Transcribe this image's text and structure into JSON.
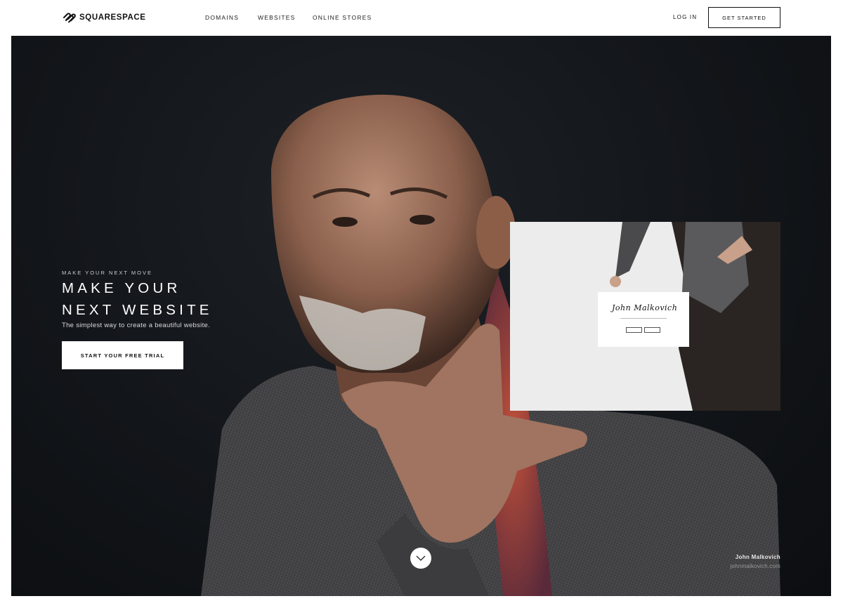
{
  "brand": {
    "name": "SQUARESPACE",
    "logo_icon": "squarespace-logo-icon"
  },
  "nav": {
    "items": [
      {
        "label": "DOMAINS"
      },
      {
        "label": "WEBSITES"
      },
      {
        "label": "ONLINE STORES"
      }
    ],
    "login_label": "LOG IN",
    "cta_label": "GET STARTED"
  },
  "hero": {
    "eyebrow": "MAKE YOUR NEXT MOVE",
    "headline_line1": "MAKE YOUR",
    "headline_line2": "NEXT WEBSITE",
    "subline": "The simplest way to create a beautiful website.",
    "cta_label": "START YOUR FREE TRIAL",
    "preview_signature": "John Malkovich",
    "credit_name": "John Malkovich",
    "credit_url": "johnmalkovich.com",
    "scroll_icon": "chevron-down-icon"
  },
  "colors": {
    "hero_background": "#121519",
    "text_light": "#ffffff",
    "button_background": "#ffffff",
    "nav_text": "#222222"
  }
}
